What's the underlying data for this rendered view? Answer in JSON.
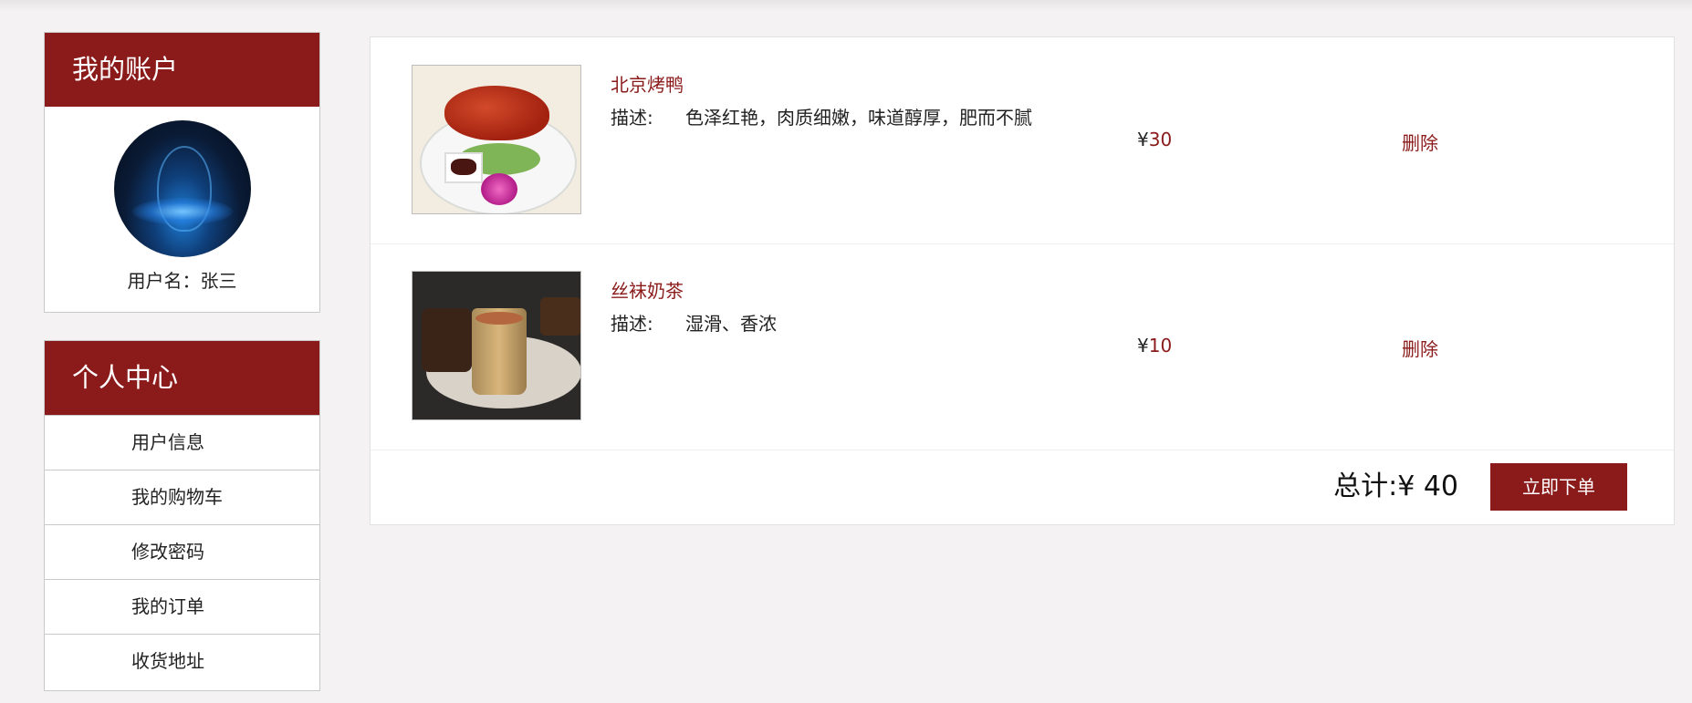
{
  "account": {
    "title": "我的账户",
    "username_label": "用户名：",
    "username": "张三"
  },
  "center": {
    "title": "个人中心",
    "items": [
      {
        "label": "用户信息"
      },
      {
        "label": "我的购物车"
      },
      {
        "label": "修改密码"
      },
      {
        "label": "我的订单"
      },
      {
        "label": "收货地址"
      }
    ]
  },
  "cart": {
    "items": [
      {
        "name": "北京烤鸭",
        "desc_label": "描述:",
        "desc": "色泽红艳，肉质细嫩，味道醇厚，肥而不腻",
        "currency": "¥",
        "price": "30",
        "delete_label": "删除"
      },
      {
        "name": "丝袜奶茶",
        "desc_label": "描述:",
        "desc": "湿滑、香浓",
        "currency": "¥",
        "price": "10",
        "delete_label": "删除"
      }
    ],
    "total_label": "总计:¥ 40",
    "order_button": "立即下单"
  },
  "colors": {
    "brand": "#8b1a1a",
    "background": "#f4f2f2"
  }
}
